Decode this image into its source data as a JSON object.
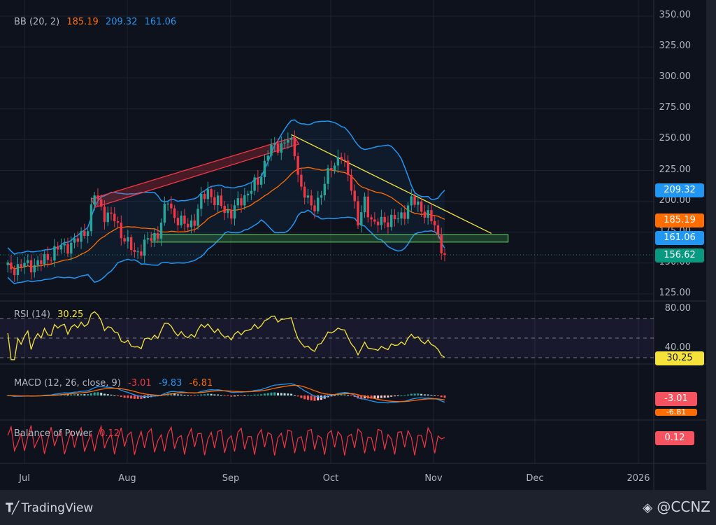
{
  "legend": {
    "bb": {
      "label": "BB (20, 2)",
      "basis": "185.19",
      "upper": "209.32",
      "lower": "161.06"
    },
    "rsi": {
      "label": "RSI (14)",
      "value": "30.25"
    },
    "macd": {
      "label": "MACD (12, 26, close, 9)",
      "hist": "-3.01",
      "macd": "-9.83",
      "signal": "-6.81"
    },
    "bop": {
      "label": "Balance of Power",
      "value": "0.12"
    }
  },
  "price_axis": [
    "350.00",
    "325.00",
    "300.00",
    "275.00",
    "250.00",
    "225.00",
    "200.00",
    "175.00",
    "150.00",
    "125.00"
  ],
  "rsi_axis": [
    "80.00",
    "40.00"
  ],
  "badges": {
    "upper": "209.32",
    "basis": "185.19",
    "lower": "161.06",
    "last": "156.62",
    "rsi": "30.25",
    "macd": "-3.01",
    "signal": "-6.81",
    "bop": "0.12"
  },
  "time_axis": [
    "Jul",
    "Aug",
    "Sep",
    "Oct",
    "Nov",
    "Dec",
    "2026"
  ],
  "footer": {
    "brand": "TradingView",
    "credit": "@CCNZ"
  },
  "colors": {
    "up": "#26a69a",
    "down": "#f23645",
    "bb_band": "#2196f3",
    "bb_basis": "#ff6d00",
    "rsi": "#f5e33a",
    "last": "#089981",
    "bg": "#0e121c"
  },
  "chart_data": {
    "type": "candlestick",
    "price_range": [
      125,
      350
    ],
    "date_range": [
      "2025-06-26",
      "2025-11-04"
    ],
    "close_keypoints": [
      [
        "2025-06-26",
        145
      ],
      [
        "2025-07-01",
        148
      ],
      [
        "2025-07-06",
        150
      ],
      [
        "2025-07-10",
        160
      ],
      [
        "2025-07-17",
        168
      ],
      [
        "2025-07-20",
        180
      ],
      [
        "2025-07-22",
        205
      ],
      [
        "2025-07-25",
        190
      ],
      [
        "2025-07-28",
        185
      ],
      [
        "2025-08-01",
        165
      ],
      [
        "2025-08-03",
        158
      ],
      [
        "2025-08-05",
        162
      ],
      [
        "2025-08-08",
        170
      ],
      [
        "2025-08-10",
        175
      ],
      [
        "2025-08-13",
        200
      ],
      [
        "2025-08-15",
        188
      ],
      [
        "2025-08-18",
        180
      ],
      [
        "2025-08-21",
        185
      ],
      [
        "2025-08-23",
        200
      ],
      [
        "2025-08-25",
        210
      ],
      [
        "2025-08-27",
        200
      ],
      [
        "2025-09-01",
        190
      ],
      [
        "2025-09-05",
        205
      ],
      [
        "2025-09-09",
        215
      ],
      [
        "2025-09-12",
        240
      ],
      [
        "2025-09-15",
        245
      ],
      [
        "2025-09-18",
        250
      ],
      [
        "2025-09-20",
        240
      ],
      [
        "2025-09-22",
        210
      ],
      [
        "2025-09-25",
        195
      ],
      [
        "2025-09-28",
        205
      ],
      [
        "2025-10-01",
        230
      ],
      [
        "2025-10-04",
        235
      ],
      [
        "2025-10-07",
        215
      ],
      [
        "2025-10-09",
        180
      ],
      [
        "2025-10-11",
        200
      ],
      [
        "2025-10-14",
        180
      ],
      [
        "2025-10-17",
        185
      ],
      [
        "2025-10-21",
        185
      ],
      [
        "2025-10-25",
        200
      ],
      [
        "2025-10-28",
        195
      ],
      [
        "2025-11-01",
        180
      ],
      [
        "2025-11-04",
        156.62
      ]
    ],
    "last_price": 156.62,
    "indicators": {
      "bollinger": {
        "period": 20,
        "mult": 2,
        "basis": 185.19,
        "upper": 209.32,
        "lower": 161.06
      },
      "rsi": {
        "period": 14,
        "value": 30.25,
        "levels": [
          70,
          50,
          30
        ]
      },
      "macd": {
        "fast": 12,
        "slow": 26,
        "signal": 9,
        "histogram": -3.01,
        "macd": -9.83,
        "signal_value": -6.81
      },
      "bop": {
        "value": 0.12
      }
    },
    "drawings": [
      {
        "type": "rising-channel",
        "from": [
          "2025-07-21",
          202
        ],
        "to": [
          "2025-09-20",
          252
        ]
      },
      {
        "type": "trendline",
        "from": [
          "2025-09-19",
          254
        ],
        "to": [
          "2025-11-18",
          174
        ]
      },
      {
        "type": "support-zone",
        "from": "2025-08-08",
        "to": "2025-11-23",
        "range": [
          167,
          173
        ]
      }
    ]
  }
}
